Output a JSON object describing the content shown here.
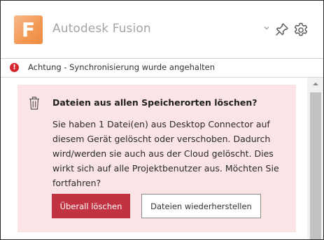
{
  "app": {
    "title": "Autodesk Fusion",
    "logo_letter": "F",
    "logo_color": "#f39a57"
  },
  "header": {
    "dropdown_icon": "chevron-down-icon",
    "pin_icon": "pin-icon",
    "settings_icon": "gear-icon"
  },
  "status": {
    "icon": "alert-circle-icon",
    "icon_glyph": "!",
    "text": "Achtung - Synchronisierung wurde angehalten",
    "color": "#d8262f"
  },
  "dialog": {
    "icon": "trash-icon",
    "title": "Dateien aus allen Speicherorten löschen?",
    "message": "Sie haben 1 Datei(en) aus Desktop Connector auf diesem Gerät gelöscht oder verschoben. Dadurch wird/werden sie auch aus der Cloud gelöscht. Dies wirkt sich auf alle Projektbenutzer aus. Möchten Sie fortfahren?",
    "background": "#fbe4e6",
    "primary_button": "Überall löschen",
    "primary_color": "#c23342",
    "secondary_button": "Dateien wiederherstellen"
  }
}
